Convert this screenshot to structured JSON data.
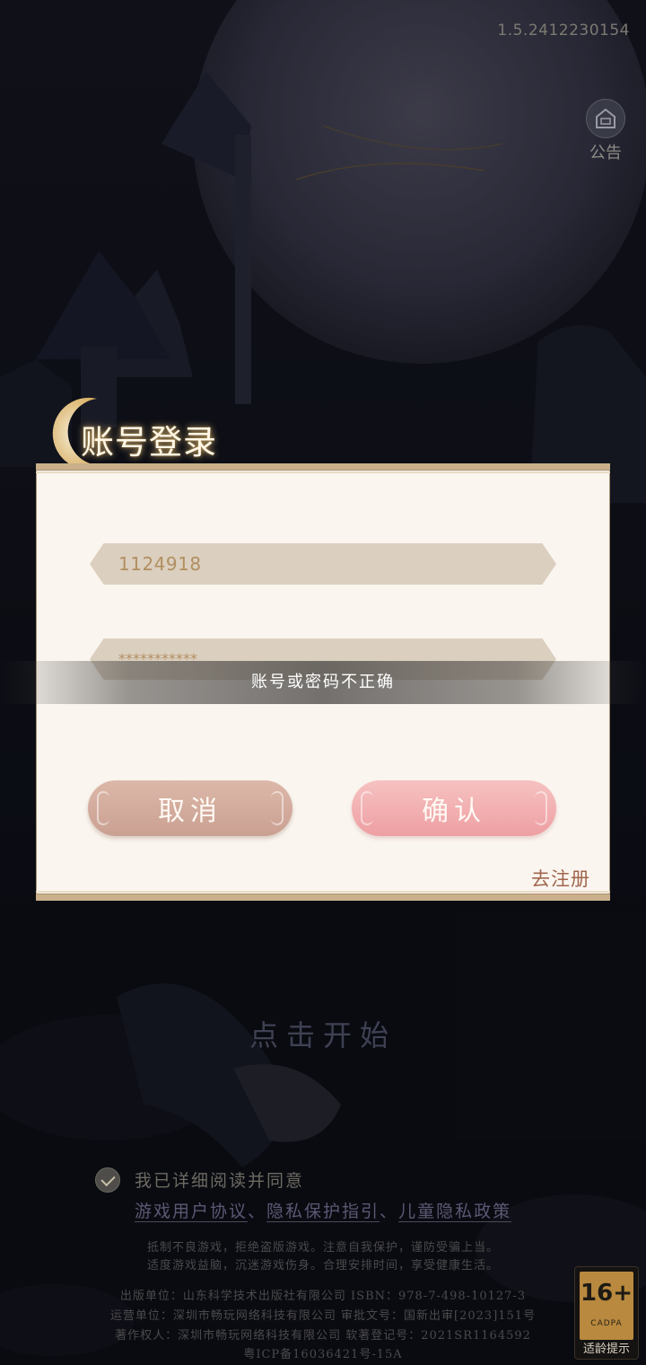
{
  "version": "1.5.2412230154",
  "notice_label": "公告",
  "login_title": "账号登录",
  "form": {
    "account_value": "1124918",
    "password_value": "***********"
  },
  "error_toast": "账号或密码不正确",
  "buttons": {
    "cancel": "取消",
    "confirm": "确认",
    "register": "去注册"
  },
  "tap_to_start": "点击开始",
  "agreement": {
    "checked": true,
    "text": "我已详细阅读并同意",
    "links": [
      "游戏用户协议",
      "隐私保护指引",
      "儿童隐私政策"
    ],
    "separator": "、"
  },
  "legal": {
    "line1": "抵制不良游戏，拒绝盗版游戏。注意自我保护，谨防受骗上当。",
    "line2": "适度游戏益脑，沉迷游戏伤身。合理安排时间，享受健康生活。",
    "line3": "出版单位：山东科学技术出版社有限公司  ISBN：978-7-498-10127-3",
    "line4": "运营单位：深圳市畅玩网络科技有限公司  审批文号：国新出审[2023]151号",
    "line5": "著作权人：深圳市畅玩网络科技有限公司  软著登记号：2021SR1164592",
    "line6": "粤ICP备16036421号-15A"
  },
  "age_rating": {
    "number": "16+",
    "org": "CADPA",
    "tip": "适龄提示"
  },
  "colors": {
    "dialog_bg": "#faf5ef",
    "field_bg": "#dbcfbf",
    "cancel_btn": "#d4ad9f",
    "confirm_btn": "#f2b1b2",
    "register_text": "#a0654c"
  }
}
